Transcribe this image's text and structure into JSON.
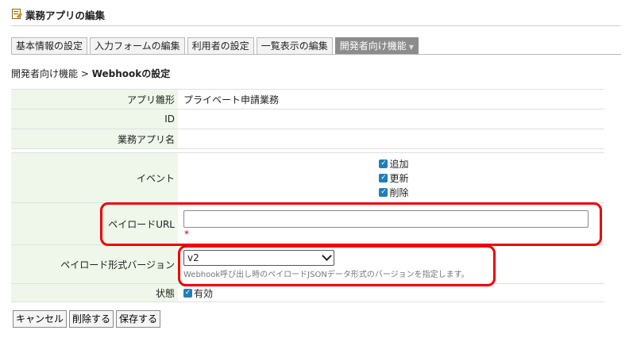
{
  "header": {
    "title": "業務アプリの編集",
    "icon": "app-edit-icon"
  },
  "tabs": [
    {
      "label": "基本情報の設定"
    },
    {
      "label": "入力フォームの編集"
    },
    {
      "label": "利用者の設定"
    },
    {
      "label": "一覧表示の編集"
    },
    {
      "label": "開発者向け機能",
      "active": true
    }
  ],
  "breadcrumb": {
    "parent": "開発者向け機能",
    "separator": " > ",
    "current": "Webhookの設定"
  },
  "form": {
    "template_label": "アプリ雛形",
    "template_value": "プライベート申請業務",
    "id_label": "ID",
    "id_value": "",
    "app_name_label": "業務アプリ名",
    "app_name_value": "",
    "event_label": "イベント",
    "events": [
      {
        "label": "追加",
        "checked": true
      },
      {
        "label": "更新",
        "checked": true
      },
      {
        "label": "削除",
        "checked": true
      }
    ],
    "payload_url_label": "ペイロードURL",
    "payload_url_value": "",
    "required_mark": "*",
    "payload_version_label": "ペイロード形式バージョン",
    "payload_version_value": "v2",
    "payload_version_hint": "Webhook呼び出し時のペイロードJSONデータ形式のバージョンを指定します。",
    "status_label": "状態",
    "status_option": "有効",
    "status_checked": true
  },
  "buttons": {
    "cancel": "キャンセル",
    "delete": "削除する",
    "save": "保存する"
  },
  "colors": {
    "label_bg": "#eef7ea",
    "checkbox": "#1f7fb8",
    "highlight": "#ee0000",
    "active_tab": "#8c8c8c"
  }
}
